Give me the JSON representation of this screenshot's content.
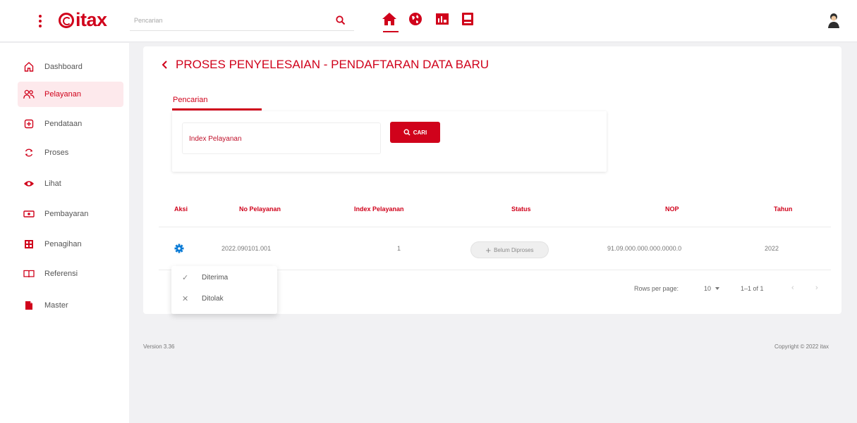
{
  "header": {
    "logo_text": "itax",
    "search_placeholder": "Pencarian",
    "nav_icons": [
      "home-icon",
      "globe-icon",
      "report-icon",
      "book-icon"
    ],
    "accent_color": "#d0021b"
  },
  "sidebar": {
    "items": [
      {
        "label": "Dashboard",
        "icon": "home-outline-icon",
        "active": false
      },
      {
        "label": "Pelayanan",
        "icon": "users-icon",
        "active": true
      },
      {
        "label": "Pendataan",
        "icon": "plus-square-icon",
        "active": false
      },
      {
        "label": "Proses",
        "icon": "refresh-icon",
        "active": false
      },
      {
        "label": "Lihat",
        "icon": "eye-icon",
        "active": false
      },
      {
        "label": "Pembayaran",
        "icon": "payment-icon",
        "active": false
      },
      {
        "label": "Penagihan",
        "icon": "billing-icon",
        "active": false
      },
      {
        "label": "Referensi",
        "icon": "book-open-icon",
        "active": false
      },
      {
        "label": "Master",
        "icon": "file-icon",
        "active": false
      }
    ]
  },
  "main": {
    "title": "PROSES PENYELESAIAN - PENDAFTARAN DATA BARU",
    "tab_label": "Pencarian",
    "index_field_placeholder": "Index Pelayanan",
    "search_button": "CARI"
  },
  "table": {
    "columns": [
      "Aksi",
      "No Pelayanan",
      "Index Pelayanan",
      "Status",
      "NOP",
      "Tahun"
    ],
    "rows": [
      {
        "no_pelayanan": "2022.090101.001",
        "index_pelayanan": "1",
        "status": "Belum Diproses",
        "nop": "91.09.000.000.000.0000.0",
        "tahun": "2022"
      }
    ]
  },
  "action_menu": {
    "items": [
      {
        "label": "Diterima",
        "icon": "check-icon"
      },
      {
        "label": "Ditolak",
        "icon": "close-icon"
      }
    ]
  },
  "pagination": {
    "rows_per_page_label": "Rows per page:",
    "rows_per_page_value": "10",
    "range": "1–1 of 1"
  },
  "footer": {
    "version": "Version 3.36",
    "copyright": "Copyright © 2022 itax"
  }
}
